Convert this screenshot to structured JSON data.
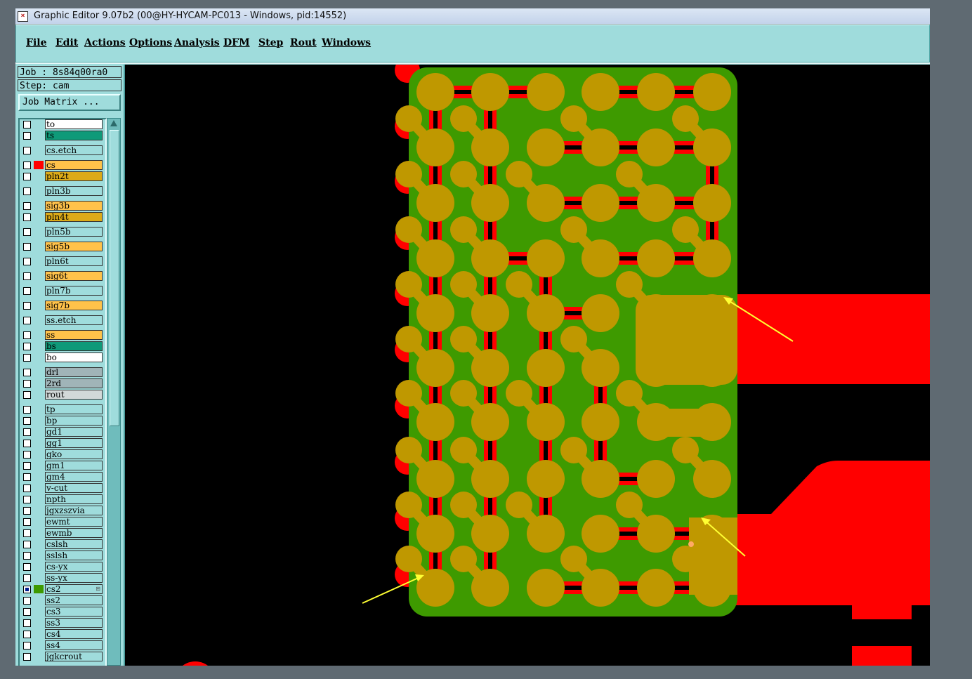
{
  "window": {
    "title": "Graphic Editor 9.07b2 (00@HY-HYCAM-PC013 - Windows, pid:14552)"
  },
  "menu": [
    {
      "label": "File"
    },
    {
      "label": "Edit"
    },
    {
      "label": "Actions"
    },
    {
      "label": "Options"
    },
    {
      "label": "Analysis"
    },
    {
      "label": "DFM"
    },
    {
      "label": "Step"
    },
    {
      "label": "Rout"
    },
    {
      "label": "Windows"
    }
  ],
  "panel": {
    "job": "Job : 8s84q00ra0",
    "step": "Step: cam",
    "job_matrix": "Job Matrix ..."
  },
  "colors": {
    "green_board": "#3e9a00",
    "copper_pad": "#bf9800",
    "red_feature": "#ff0000",
    "arrow": "#ffff33",
    "canvas_bg": "#000000"
  },
  "layers": [
    {
      "name": "to",
      "color": "#ffffff",
      "checked": false,
      "swatch": ""
    },
    {
      "name": "ts",
      "color": "#0f9a79",
      "checked": false,
      "swatch": ""
    },
    {
      "name": "cs.etch",
      "color": "#9fdcdc",
      "checked": false,
      "swatch": ""
    },
    {
      "name": "cs",
      "color": "#ffc24a",
      "checked": false,
      "swatch": "#ff0000"
    },
    {
      "name": "pln2t",
      "color": "#dcaa18",
      "checked": false,
      "swatch": ""
    },
    {
      "name": "pln3b",
      "color": "#9fdcdc",
      "checked": false,
      "swatch": ""
    },
    {
      "name": "sig3b",
      "color": "#ffc24a",
      "checked": false,
      "swatch": ""
    },
    {
      "name": "pln4t",
      "color": "#dcaa18",
      "checked": false,
      "swatch": ""
    },
    {
      "name": "pln5b",
      "color": "#9fdcdc",
      "checked": false,
      "swatch": ""
    },
    {
      "name": "sig5b",
      "color": "#ffc24a",
      "checked": false,
      "swatch": ""
    },
    {
      "name": "pln6t",
      "color": "#9fdcdc",
      "checked": false,
      "swatch": ""
    },
    {
      "name": "sig6t",
      "color": "#ffc24a",
      "checked": false,
      "swatch": ""
    },
    {
      "name": "pln7b",
      "color": "#9fdcdc",
      "checked": false,
      "swatch": ""
    },
    {
      "name": "sig7b",
      "color": "#ffc24a",
      "checked": false,
      "swatch": ""
    },
    {
      "name": "ss.etch",
      "color": "#9fdcdc",
      "checked": false,
      "swatch": ""
    },
    {
      "name": "ss",
      "color": "#ffc24a",
      "checked": false,
      "swatch": ""
    },
    {
      "name": "bs",
      "color": "#0f9a79",
      "checked": false,
      "swatch": ""
    },
    {
      "name": "bo",
      "color": "#ffffff",
      "checked": false,
      "swatch": ""
    },
    {
      "name": "drl",
      "color": "#a0b4b8",
      "checked": false,
      "swatch": ""
    },
    {
      "name": "2rd",
      "color": "#a0b4b8",
      "checked": false,
      "swatch": ""
    },
    {
      "name": "rout",
      "color": "#d2d8d8",
      "checked": false,
      "swatch": ""
    },
    {
      "name": "tp",
      "color": "#9fdcdc",
      "checked": false,
      "swatch": ""
    },
    {
      "name": "bp",
      "color": "#9fdcdc",
      "checked": false,
      "swatch": ""
    },
    {
      "name": "gd1",
      "color": "#9fdcdc",
      "checked": false,
      "swatch": ""
    },
    {
      "name": "gg1",
      "color": "#9fdcdc",
      "checked": false,
      "swatch": ""
    },
    {
      "name": "gko",
      "color": "#9fdcdc",
      "checked": false,
      "swatch": ""
    },
    {
      "name": "gm1",
      "color": "#9fdcdc",
      "checked": false,
      "swatch": ""
    },
    {
      "name": "gm4",
      "color": "#9fdcdc",
      "checked": false,
      "swatch": ""
    },
    {
      "name": "v-cut",
      "color": "#9fdcdc",
      "checked": false,
      "swatch": ""
    },
    {
      "name": "npth",
      "color": "#9fdcdc",
      "checked": false,
      "swatch": ""
    },
    {
      "name": "jgxzszvia",
      "color": "#9fdcdc",
      "checked": false,
      "swatch": ""
    },
    {
      "name": "ewmt",
      "color": "#9fdcdc",
      "checked": false,
      "swatch": ""
    },
    {
      "name": "ewmb",
      "color": "#9fdcdc",
      "checked": false,
      "swatch": ""
    },
    {
      "name": "cslsh",
      "color": "#9fdcdc",
      "checked": false,
      "swatch": ""
    },
    {
      "name": "sslsh",
      "color": "#9fdcdc",
      "checked": false,
      "swatch": ""
    },
    {
      "name": "cs-yx",
      "color": "#9fdcdc",
      "checked": false,
      "swatch": ""
    },
    {
      "name": "ss-yx",
      "color": "#9fdcdc",
      "checked": false,
      "swatch": ""
    },
    {
      "name": "cs2",
      "color": "#9fdcdc",
      "checked": true,
      "swatch": "#3e9a00",
      "mark": "⊞"
    },
    {
      "name": "ss2",
      "color": "#9fdcdc",
      "checked": false,
      "swatch": ""
    },
    {
      "name": "cs3",
      "color": "#9fdcdc",
      "checked": false,
      "swatch": ""
    },
    {
      "name": "ss3",
      "color": "#9fdcdc",
      "checked": false,
      "swatch": ""
    },
    {
      "name": "cs4",
      "color": "#9fdcdc",
      "checked": false,
      "swatch": ""
    },
    {
      "name": "ss4",
      "color": "#9fdcdc",
      "checked": false,
      "swatch": ""
    },
    {
      "name": "jgkcrout",
      "color": "#9fdcdc",
      "checked": false,
      "swatch": ""
    }
  ]
}
